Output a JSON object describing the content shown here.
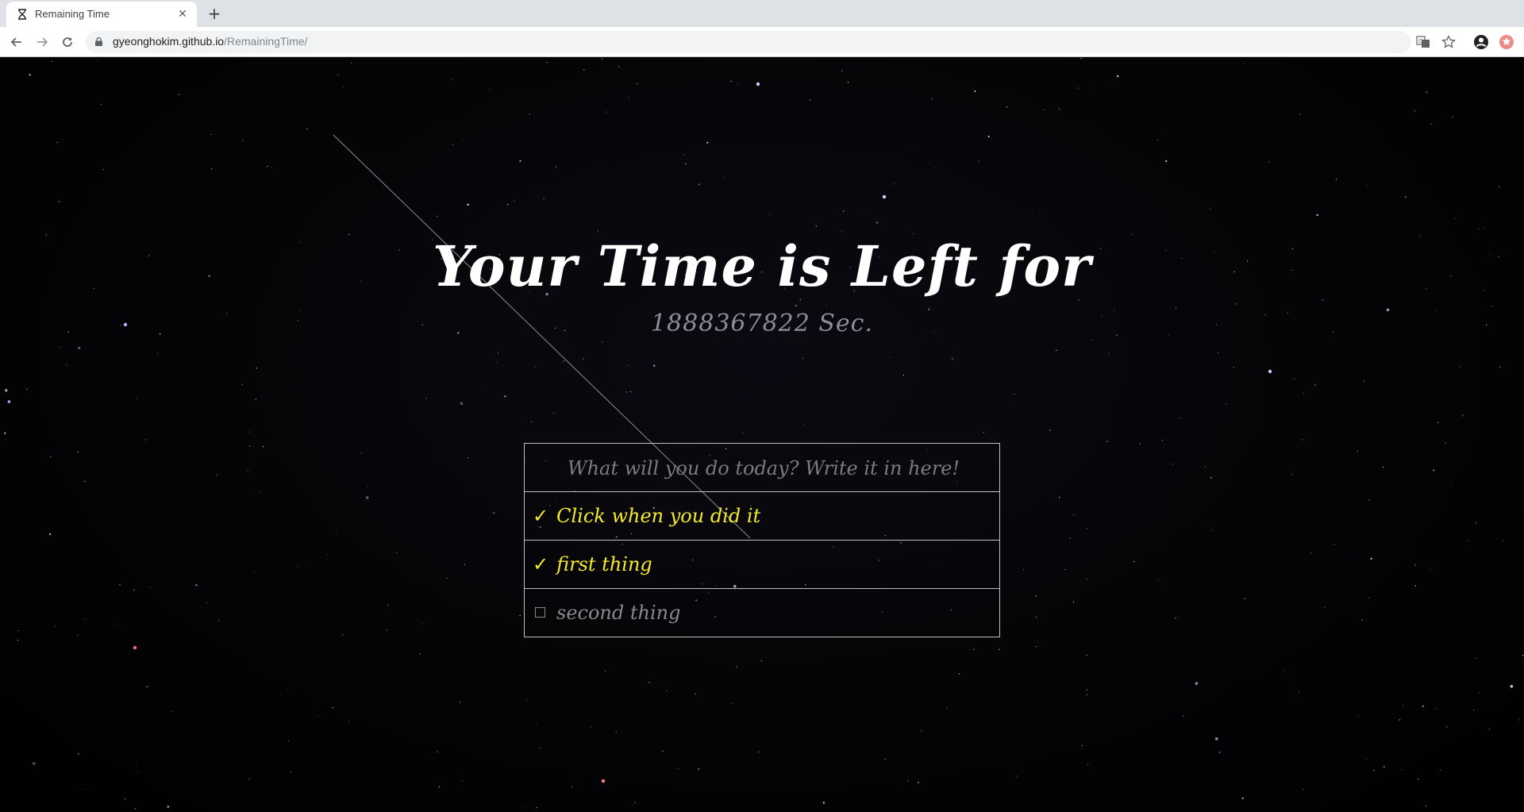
{
  "browser": {
    "tab": {
      "title": "Remaining Time",
      "icon": "hourglass-icon"
    },
    "new_tab_label": "+",
    "url": {
      "host": "gyeonghokim.github.io",
      "path": "/RemainingTime/"
    }
  },
  "main": {
    "headline": "Your Time is Left for",
    "counter": "1888367822 Sec.",
    "todo": {
      "placeholder": "What will you do today? Write it in here!",
      "items": [
        {
          "label": "Click when you did it",
          "done": true,
          "mark": "✓"
        },
        {
          "label": "first thing",
          "done": true,
          "mark": "✓"
        },
        {
          "label": "second thing",
          "done": false,
          "mark": ""
        }
      ]
    }
  },
  "colors": {
    "done": "#f4ea2a",
    "pending": "#8a8a8a",
    "background": "#000000"
  }
}
